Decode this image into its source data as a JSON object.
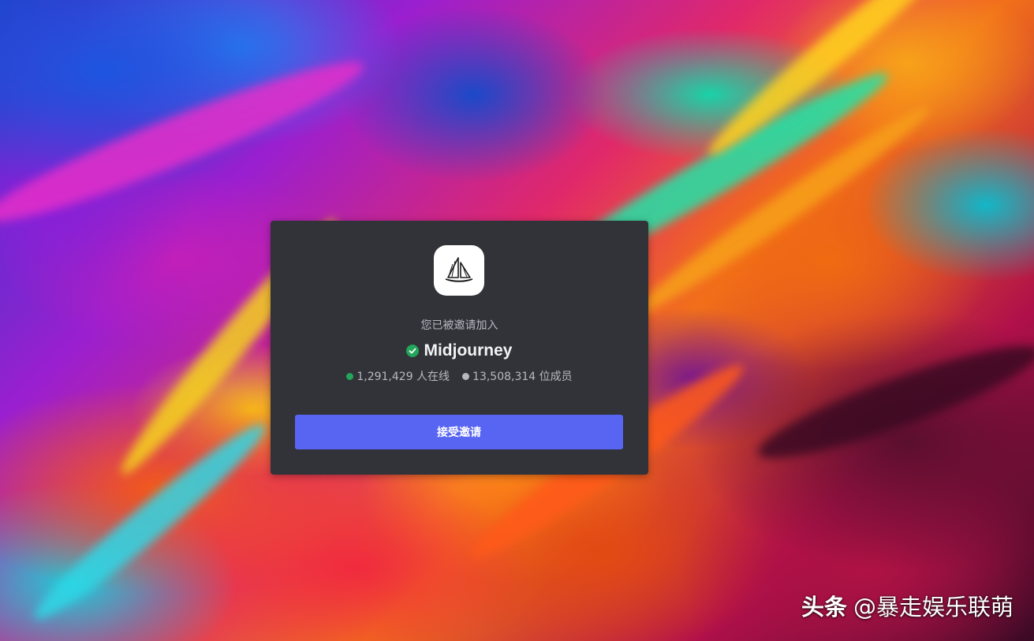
{
  "invite": {
    "invited_text": "您已被邀请加入",
    "server_name": "Midjourney",
    "verified_icon": "verified-check-icon",
    "verified_color": "#23a55a",
    "online_count": "1,291,429 人在线",
    "online_dot_color": "#23a55a",
    "member_count": "13,508,314 位成员",
    "member_dot_color": "#b5bac1",
    "accept_button_label": "接受邀请",
    "accept_button_color": "#5865f2",
    "logo_icon": "midjourney-sailboat-logo"
  },
  "watermark": {
    "brand": "头条",
    "handle": "@暴走娱乐联萌"
  }
}
